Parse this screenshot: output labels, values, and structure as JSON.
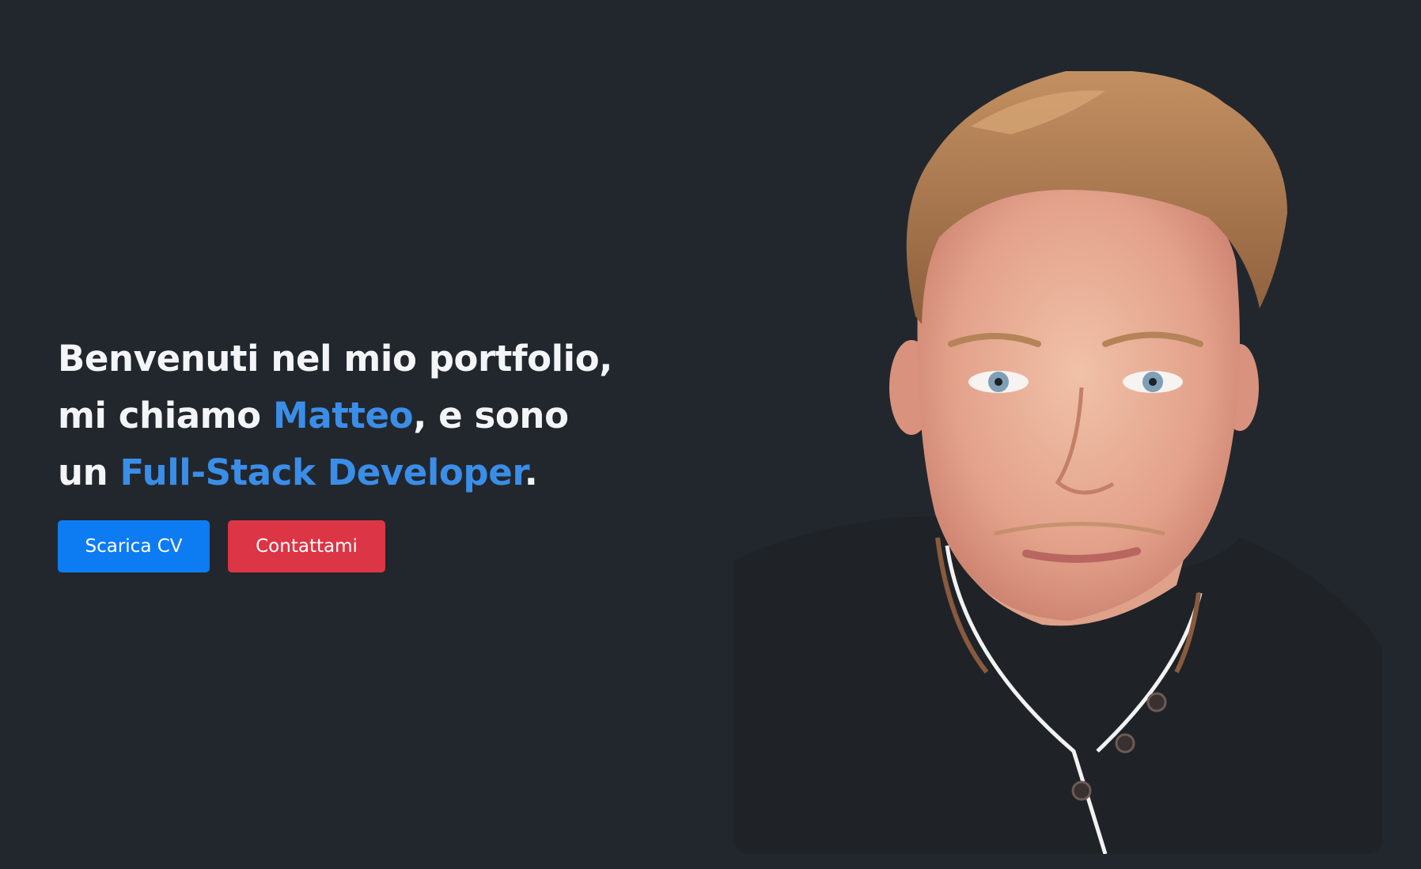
{
  "hero": {
    "line1": "Benvenuti nel mio portfolio,",
    "line2_before": "mi chiamo ",
    "line2_name": "Matteo",
    "line2_after": ", e sono",
    "line3_before": "un ",
    "line3_role": "Full-Stack Developer",
    "line3_after": "."
  },
  "actions": {
    "download_cv": "Scarica CV",
    "contact": "Contattami"
  },
  "colors": {
    "background": "#22272d",
    "text": "#f4f5f7",
    "accent": "#3b8ee8",
    "primary_button": "#0d7cf2",
    "danger_button": "#dc3545"
  },
  "portrait": {
    "icon": "profile-photo-icon"
  }
}
